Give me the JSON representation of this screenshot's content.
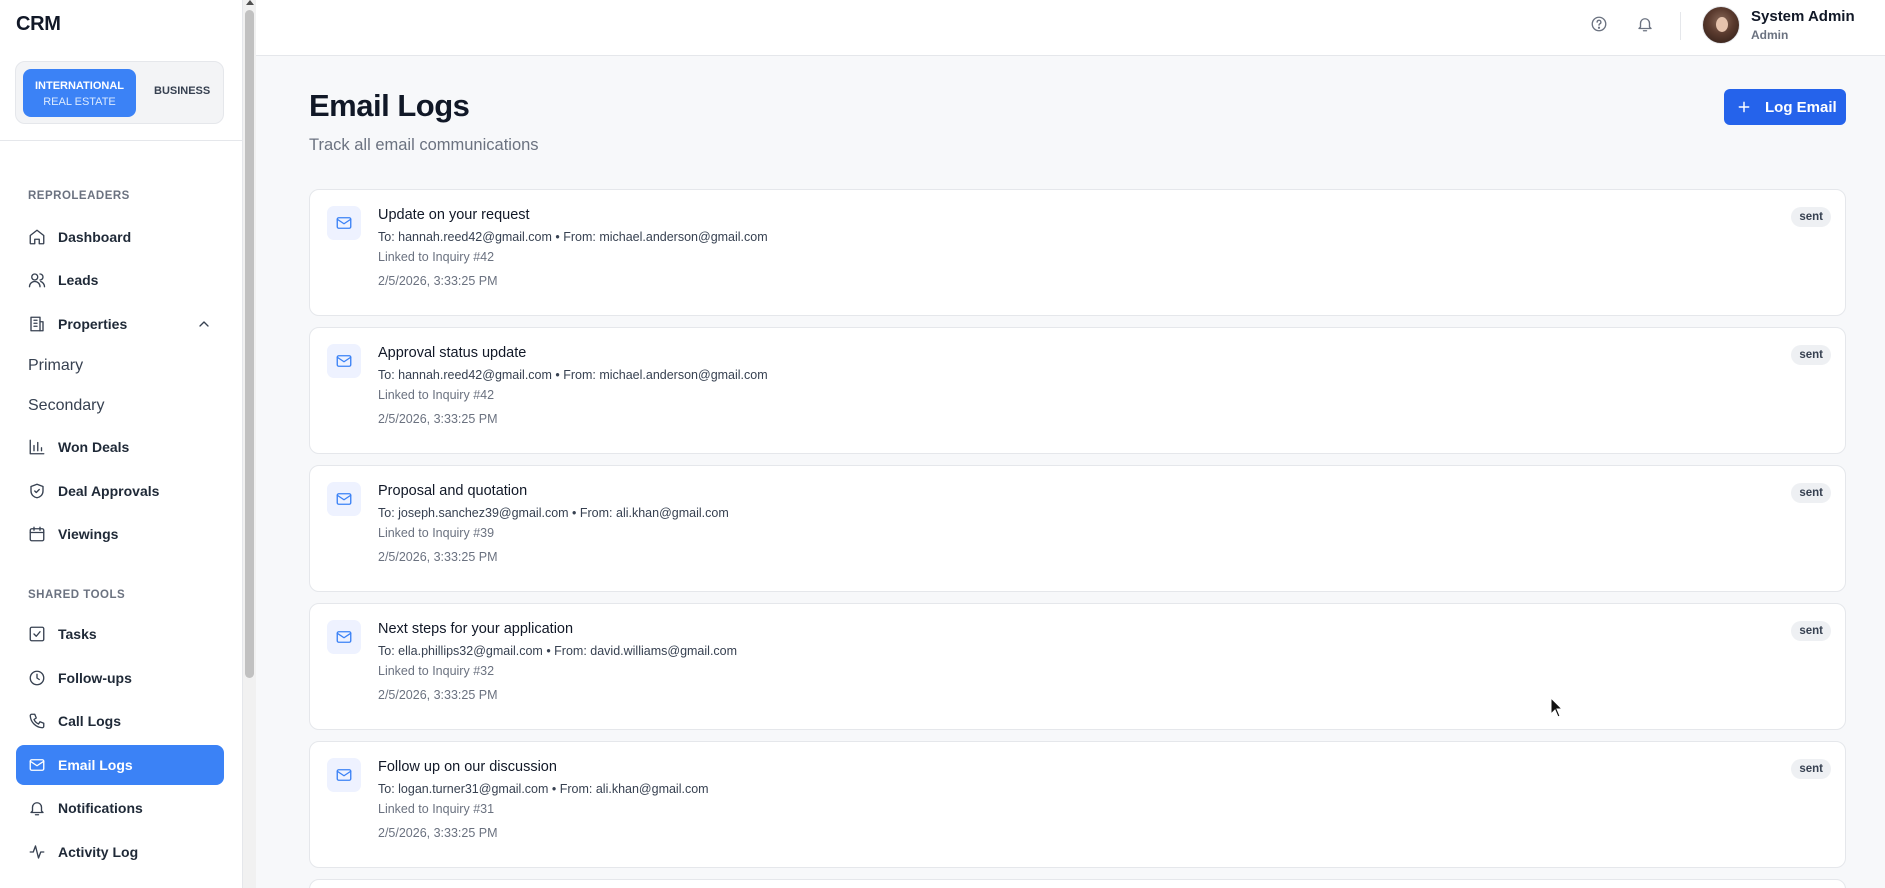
{
  "app": {
    "brand": "CRM"
  },
  "switcher": {
    "active_line1": "INTERNATIONAL",
    "active_line2": "REAL ESTATE",
    "inactive": "BUSINESS"
  },
  "sidebar": {
    "section1": "REPROLEADERS",
    "items1": [
      {
        "label": "Dashboard",
        "icon": "home-icon"
      },
      {
        "label": "Leads",
        "icon": "users-icon"
      },
      {
        "label": "Properties",
        "icon": "building-icon",
        "expanded": true
      }
    ],
    "sub_items": [
      "Primary",
      "Secondary"
    ],
    "items2": [
      {
        "label": "Won Deals",
        "icon": "bar-chart-icon"
      },
      {
        "label": "Deal Approvals",
        "icon": "shield-check-icon"
      },
      {
        "label": "Viewings",
        "icon": "calendar-icon"
      }
    ],
    "section2": "SHARED TOOLS",
    "items3": [
      {
        "label": "Tasks",
        "icon": "checkbox-icon"
      },
      {
        "label": "Follow-ups",
        "icon": "clock-icon"
      },
      {
        "label": "Call Logs",
        "icon": "phone-icon"
      },
      {
        "label": "Email Logs",
        "icon": "mail-icon",
        "active": true
      },
      {
        "label": "Notifications",
        "icon": "bell-icon"
      },
      {
        "label": "Activity Log",
        "icon": "activity-icon"
      }
    ]
  },
  "header": {
    "user_name": "System Admin",
    "user_role": "Admin"
  },
  "page": {
    "title": "Email Logs",
    "subtitle": "Track all email communications",
    "log_button": "Log Email"
  },
  "emails": [
    {
      "subject": "Update on your request",
      "meta": "To: hannah.reed42@gmail.com • From: michael.anderson@gmail.com",
      "linked": "Linked to Inquiry #42",
      "time": "2/5/2026, 3:33:25 PM",
      "status": "sent"
    },
    {
      "subject": "Approval status update",
      "meta": "To: hannah.reed42@gmail.com • From: michael.anderson@gmail.com",
      "linked": "Linked to Inquiry #42",
      "time": "2/5/2026, 3:33:25 PM",
      "status": "sent"
    },
    {
      "subject": "Proposal and quotation",
      "meta": "To: joseph.sanchez39@gmail.com • From: ali.khan@gmail.com",
      "linked": "Linked to Inquiry #39",
      "time": "2/5/2026, 3:33:25 PM",
      "status": "sent"
    },
    {
      "subject": "Next steps for your application",
      "meta": "To: ella.phillips32@gmail.com • From: david.williams@gmail.com",
      "linked": "Linked to Inquiry #32",
      "time": "2/5/2026, 3:33:25 PM",
      "status": "sent"
    },
    {
      "subject": "Follow up on our discussion",
      "meta": "To: logan.turner31@gmail.com • From: ali.khan@gmail.com",
      "linked": "Linked to Inquiry #31",
      "time": "2/5/2026, 3:33:25 PM",
      "status": "sent"
    }
  ],
  "colors": {
    "accent": "#3b82f6",
    "primary_button": "#2563eb"
  }
}
